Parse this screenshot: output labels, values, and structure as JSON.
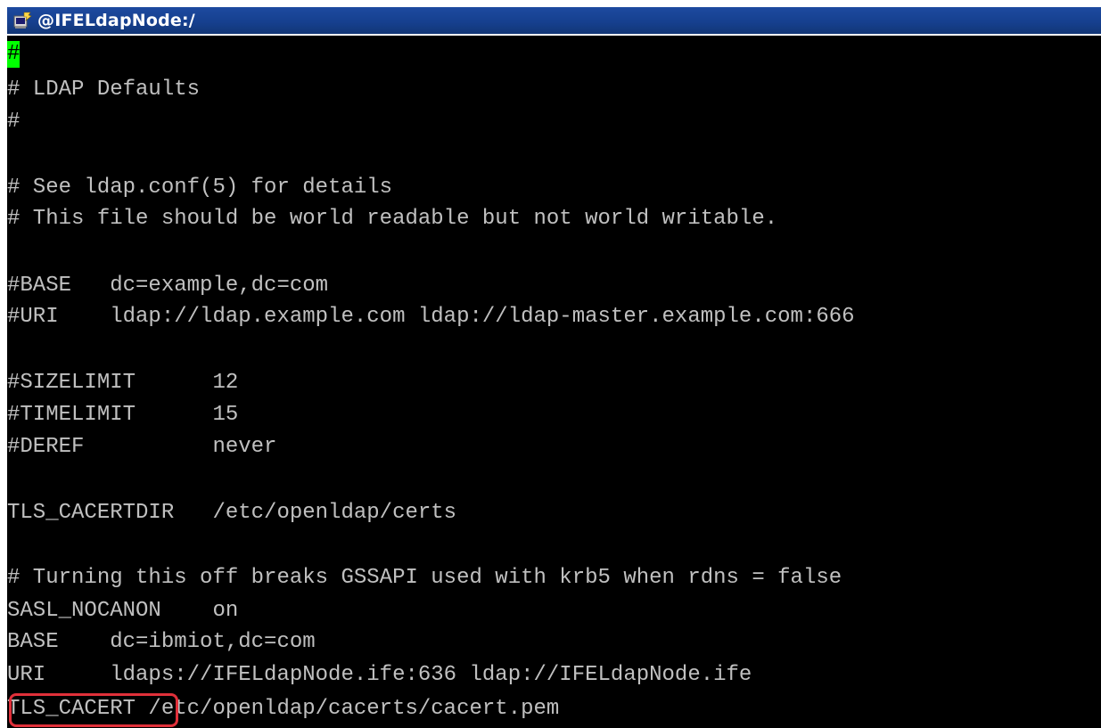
{
  "window": {
    "title": "@IFELdapNode:/",
    "icon": "putty-terminal-icon"
  },
  "terminal": {
    "cursor_char": "#",
    "lines": [
      "",
      "# LDAP Defaults",
      "#",
      "",
      "# See ldap.conf(5) for details",
      "# This file should be world readable but not world writable.",
      "",
      "#BASE   dc=example,dc=com",
      "#URI    ldap://ldap.example.com ldap://ldap-master.example.com:666",
      "",
      "#SIZELIMIT      12",
      "#TIMELIMIT      15",
      "#DEREF          never",
      "",
      "TLS_CACERTDIR   /etc/openldap/certs",
      "",
      "# Turning this off breaks GSSAPI used with krb5 when rdns = false",
      "SASL_NOCANON    on",
      "BASE    dc=ibmiot,dc=com",
      "URI     ldaps://IFELdapNode.ife:636 ldap://IFELdapNode.ife",
      "TLS_CACERT /etc/openldap/cacerts/cacert.pem"
    ]
  },
  "highlight": {
    "target_text": "TLS_CACERT",
    "color": "#e0303a"
  },
  "colors": {
    "terminal_bg": "#000000",
    "terminal_fg": "#c0c0c0",
    "cursor": "#00ff00",
    "titlebar": "#16408f"
  }
}
